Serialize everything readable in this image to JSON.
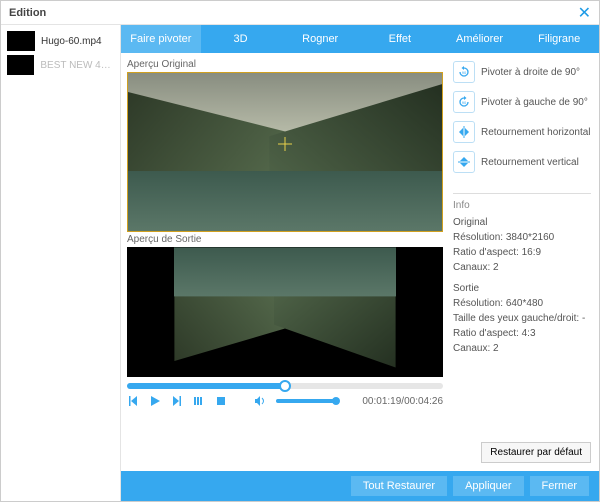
{
  "window": {
    "title": "Edition"
  },
  "sidebar": {
    "items": [
      {
        "name": "Hugo-60.mp4",
        "active": true
      },
      {
        "name": "BEST NEW 4K...",
        "active": false
      }
    ]
  },
  "tabs": [
    {
      "label": "Faire pivoter",
      "active": true
    },
    {
      "label": "3D"
    },
    {
      "label": "Rogner"
    },
    {
      "label": "Effet"
    },
    {
      "label": "Améliorer"
    },
    {
      "label": "Filigrane"
    }
  ],
  "preview": {
    "original_label": "Aperçu Original",
    "output_label": "Aperçu de Sortie"
  },
  "player": {
    "time": "00:01:19/00:04:26"
  },
  "rotate": {
    "right": "Pivoter à droite de 90°",
    "left": "Pivoter à gauche de 90°",
    "hflip": "Retournement horizontal",
    "vflip": "Retournement vertical"
  },
  "info": {
    "header": "Info",
    "original": {
      "title": "Original",
      "resolution_label": "Résolution:",
      "resolution": "3840*2160",
      "ratio_label": "Ratio d'aspect:",
      "ratio": "16:9",
      "channels_label": "Canaux:",
      "channels": "2"
    },
    "output": {
      "title": "Sortie",
      "resolution_label": "Résolution:",
      "resolution": "640*480",
      "eyes_label": "Taille des yeux gauche/droit:",
      "eyes": "-",
      "ratio_label": "Ratio d'aspect:",
      "ratio": "4:3",
      "channels_label": "Canaux:",
      "channels": "2"
    }
  },
  "buttons": {
    "restore_default": "Restaurer par défaut",
    "restore_all": "Tout Restaurer",
    "apply": "Appliquer",
    "close": "Fermer"
  }
}
